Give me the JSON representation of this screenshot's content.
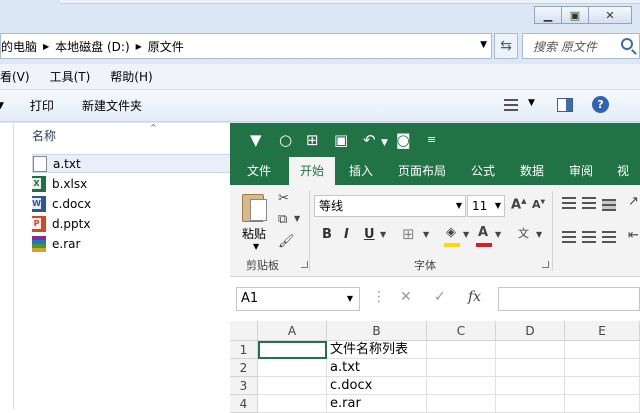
{
  "explorer": {
    "breadcrumb": [
      "的电脑",
      "本地磁盘 (D:)",
      "原文件"
    ],
    "search_placeholder": "搜索 原文件",
    "menu": [
      "看(V)",
      "工具(T)",
      "帮助(H)"
    ],
    "toolbar": {
      "print": "打印",
      "new_folder": "新建文件夹"
    },
    "column_header": "名称",
    "files": [
      {
        "name": "a.txt",
        "icon": "txt-file-icon",
        "selected": true
      },
      {
        "name": "b.xlsx",
        "icon": "excel-file-icon"
      },
      {
        "name": "c.docx",
        "icon": "word-file-icon"
      },
      {
        "name": "d.pptx",
        "icon": "powerpoint-file-icon"
      },
      {
        "name": "e.rar",
        "icon": "rar-archive-icon"
      }
    ]
  },
  "excel": {
    "tabs": [
      "文件",
      "开始",
      "插入",
      "页面布局",
      "公式",
      "数据",
      "审阅",
      "视图"
    ],
    "active_tab": "开始",
    "clipboard": {
      "paste": "粘贴",
      "group": "剪贴板"
    },
    "font": {
      "name": "等线",
      "size": "11",
      "group": "字体"
    },
    "name_box": "A1",
    "columns": [
      "A",
      "B",
      "C",
      "D",
      "E"
    ],
    "rows": [
      "1",
      "2",
      "3",
      "4"
    ],
    "cells_b": [
      "文件名称列表",
      "a.txt",
      "c.docx",
      "e.rar"
    ],
    "colors": {
      "accent": "#217346",
      "font_color_bar": "#d62020",
      "fill_color_bar": "#ffd800"
    }
  }
}
